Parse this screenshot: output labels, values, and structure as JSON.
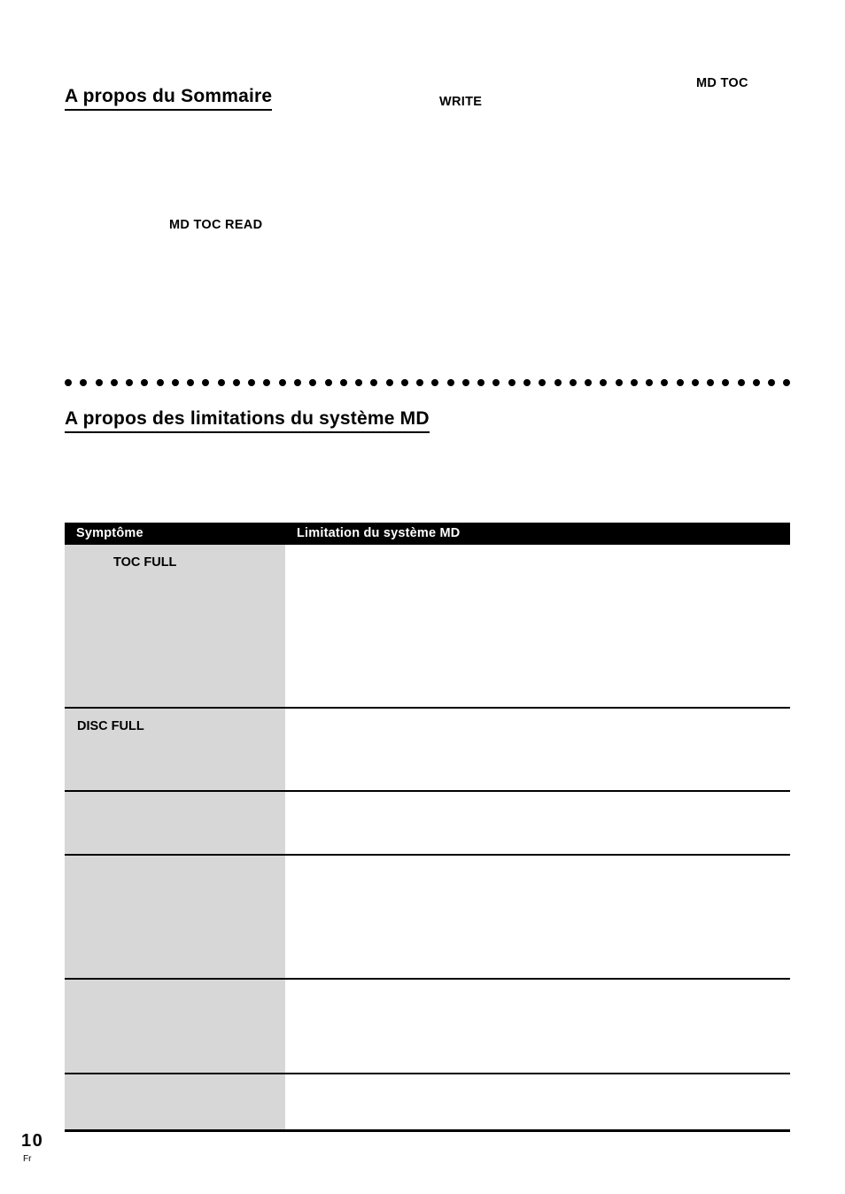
{
  "page": {
    "language_code": "Fr",
    "number": "10"
  },
  "sections": [
    {
      "heading": "A propos du Sommaire",
      "inline_labels": [
        {
          "name": "write",
          "text": "WRITE"
        },
        {
          "name": "md-toc",
          "text": "MD TOC"
        },
        {
          "name": "md-toc-read",
          "text": "MD TOC READ"
        }
      ]
    },
    {
      "heading": "A propos des limitations du système MD"
    }
  ],
  "divider": {
    "style": "dotted",
    "dot_count": 48,
    "color": "#000000"
  },
  "table": {
    "columns": [
      {
        "key": "symptom",
        "label": "Symptôme"
      },
      {
        "key": "limitation",
        "label": "Limitation du système MD"
      }
    ],
    "header_background": "#000000",
    "header_color": "#ffffff",
    "symptom_cell_background": "#d7d7d7",
    "rows": [
      {
        "symptom": "TOC FULL",
        "symptom_indented": true,
        "limitation": ""
      },
      {
        "symptom": "DISC FULL",
        "symptom_indented": false,
        "limitation": ""
      },
      {
        "symptom": "",
        "symptom_indented": false,
        "limitation": ""
      },
      {
        "symptom": "",
        "symptom_indented": false,
        "limitation": ""
      },
      {
        "symptom": "",
        "symptom_indented": false,
        "limitation": ""
      },
      {
        "symptom": "",
        "symptom_indented": false,
        "limitation": ""
      }
    ]
  }
}
